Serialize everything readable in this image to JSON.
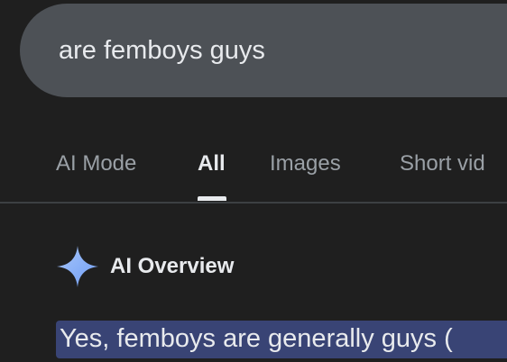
{
  "search": {
    "query": "are femboys guys"
  },
  "tabs": [
    {
      "label": "AI Mode"
    },
    {
      "label": "All"
    },
    {
      "label": "Images"
    },
    {
      "label": "Short vid"
    }
  ],
  "ai_overview": {
    "icon": "sparkle-icon",
    "title": "AI Overview",
    "answer_highlight": "Yes, femboys are generally guys ("
  },
  "colors": {
    "background": "#1f1f1f",
    "search_bar": "#4d5156",
    "text_primary": "#e8eaed",
    "text_secondary": "#9aa0a6",
    "highlight": "#394475",
    "sparkle": "#8ab4f8"
  }
}
